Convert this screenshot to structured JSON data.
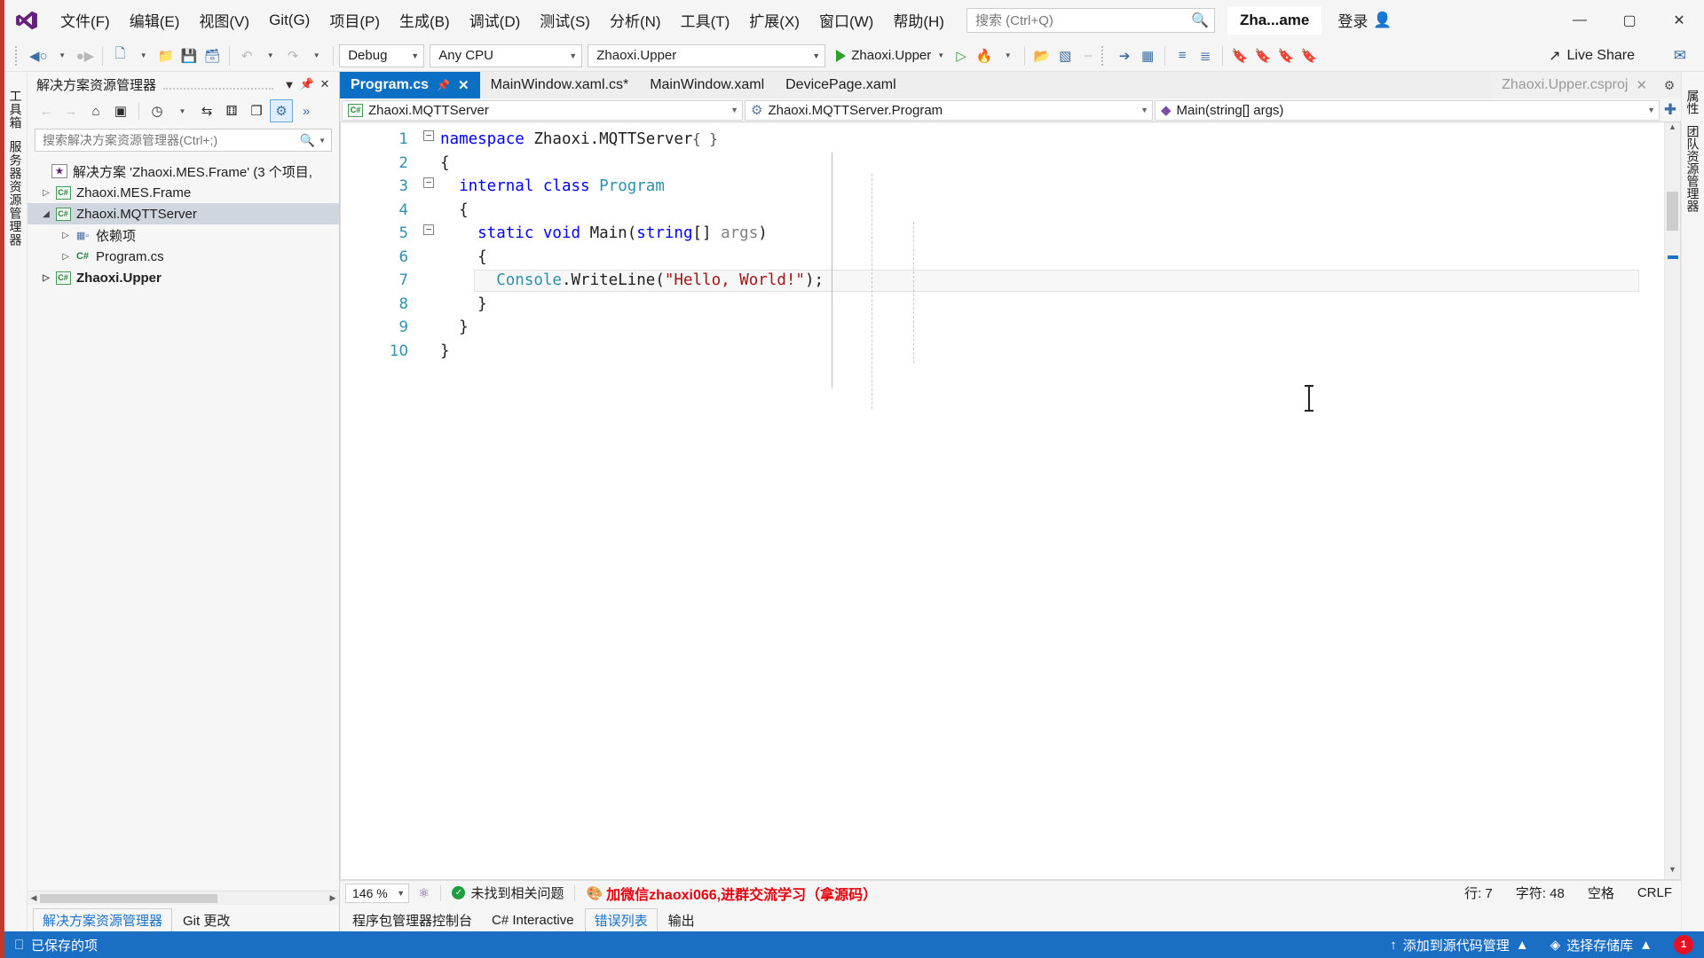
{
  "titlebar": {
    "logo_icon": "visual-studio-logo-icon",
    "menus": [
      {
        "label": "文件(F)"
      },
      {
        "label": "编辑(E)"
      },
      {
        "label": "视图(V)"
      },
      {
        "label": "Git(G)"
      },
      {
        "label": "项目(P)"
      },
      {
        "label": "生成(B)"
      },
      {
        "label": "调试(D)"
      },
      {
        "label": "测试(S)"
      },
      {
        "label": "分析(N)"
      },
      {
        "label": "工具(T)"
      },
      {
        "label": "扩展(X)"
      },
      {
        "label": "窗口(W)"
      },
      {
        "label": "帮助(H)"
      }
    ],
    "search_placeholder": "搜索 (Ctrl+Q)",
    "search_icon": "magnifier-icon",
    "solution_name": "Zha...ame",
    "signin_label": "登录",
    "signin_icon": "person-icon",
    "window_minimize": "—",
    "window_maximize": "▢",
    "window_close": "✕"
  },
  "toolbar": {
    "back_icon": "navigate-back-icon",
    "forward_icon": "navigate-forward-icon",
    "new_project_icon": "new-project-icon",
    "open_icon": "open-folder-icon",
    "save_icon": "save-icon",
    "save_all_icon": "save-all-icon",
    "undo_icon": "undo-icon",
    "redo_icon": "redo-icon",
    "config_value": "Debug",
    "platform_value": "Any CPU",
    "startup_project_value": "Zhaoxi.Upper",
    "run_label": "Zhaoxi.Upper",
    "run_icon": "play-icon",
    "run_nodebug_icon": "play-outline-icon",
    "hotreload_icon": "hot-reload-flame-icon",
    "selection_icon": "selection-icon",
    "comment_icon": "comment-icon",
    "bookmark_icon": "bookmark-icon",
    "live_share_label": "Live Share",
    "live_share_icon": "live-share-icon",
    "feedback_icon": "feedback-icon"
  },
  "left_strip": {
    "tabs": [
      {
        "label": "工具箱"
      },
      {
        "label": "服务器资源管理器"
      }
    ]
  },
  "right_strip": {
    "tabs": [
      {
        "label": "属性"
      },
      {
        "label": "团队资源管理器"
      }
    ]
  },
  "solution_explorer": {
    "title": "解决方案资源管理器",
    "pin_icon": "pin-icon",
    "dropdown_icon": "chevron-down-icon",
    "close_icon": "close-icon",
    "toolbar_icons": [
      {
        "name": "back-icon",
        "glyph": "←"
      },
      {
        "name": "forward-icon",
        "glyph": "→"
      },
      {
        "name": "home-icon",
        "glyph": "⌂"
      },
      {
        "name": "pending-changes-icon",
        "glyph": "▣"
      },
      {
        "name": "history-clock-icon",
        "glyph": "◷"
      },
      {
        "name": "sync-with-active-document-icon",
        "glyph": "⇆"
      },
      {
        "name": "collapse-all-icon",
        "glyph": "⊟"
      },
      {
        "name": "show-all-files-icon",
        "glyph": "❐"
      },
      {
        "name": "properties-icon",
        "glyph": "⚲"
      }
    ],
    "search_placeholder": "搜索解决方案资源管理器(Ctrl+;)",
    "search_icon": "magnifier-icon",
    "tree": [
      {
        "label": "解决方案 'Zhaoxi.MES.Frame' (3 个项目,",
        "indent": 0,
        "icon": "solution-icon",
        "twisty": "",
        "selected": false,
        "bold": false
      },
      {
        "label": "Zhaoxi.MES.Frame",
        "indent": 1,
        "icon": "csharp-project-icon",
        "twisty": "▷",
        "selected": false,
        "bold": false
      },
      {
        "label": "Zhaoxi.MQTTServer",
        "indent": 1,
        "icon": "csharp-project-icon",
        "twisty": "◢",
        "selected": true,
        "bold": false
      },
      {
        "label": "依赖项",
        "indent": 2,
        "icon": "dependencies-icon",
        "twisty": "▷",
        "selected": false,
        "bold": false
      },
      {
        "label": "Program.cs",
        "indent": 2,
        "icon": "csharp-file-icon",
        "twisty": "▷",
        "selected": false,
        "bold": false
      },
      {
        "label": "Zhaoxi.Upper",
        "indent": 1,
        "icon": "csharp-project-icon",
        "twisty": "▷",
        "selected": false,
        "bold": true
      }
    ],
    "bottom_tabs": [
      {
        "label": "解决方案资源管理器",
        "active": true
      },
      {
        "label": "Git 更改",
        "active": false
      }
    ]
  },
  "editor": {
    "tabs": [
      {
        "label": "Program.cs",
        "active": true,
        "pinned": true,
        "closable": true
      },
      {
        "label": "MainWindow.xaml.cs*",
        "active": false,
        "pinned": false,
        "closable": false
      },
      {
        "label": "MainWindow.xaml",
        "active": false,
        "pinned": false,
        "closable": false
      },
      {
        "label": "DevicePage.xaml",
        "active": false,
        "pinned": false,
        "closable": false
      }
    ],
    "ghost_tab": "Zhaoxi.Upper.csproj",
    "ghost_close_icon": "close-icon",
    "tabstrip_menu_icon": "gear-icon",
    "nav": {
      "project": "Zhaoxi.MQTTServer",
      "project_icon": "csharp-project-icon",
      "type": "Zhaoxi.MQTTServer.Program",
      "type_icon": "class-icon",
      "member": "Main(string[] args)",
      "member_icon": "method-icon",
      "add_icon": "plus-icon"
    },
    "code_lines": [
      {
        "n": 1,
        "fold": "minus",
        "tokens": [
          {
            "t": "namespace ",
            "c": "kw"
          },
          {
            "t": "Zhaoxi.MQTTServer",
            "c": "ns"
          }
        ]
      },
      {
        "n": 2,
        "fold": "",
        "tokens": [
          {
            "t": "{",
            "c": "ns"
          }
        ]
      },
      {
        "n": 3,
        "fold": "minus",
        "tokens": [
          {
            "t": "  internal class ",
            "c": "kw"
          },
          {
            "t": "Program",
            "c": "tp"
          }
        ]
      },
      {
        "n": 4,
        "fold": "",
        "tokens": [
          {
            "t": "  {",
            "c": "ns"
          }
        ]
      },
      {
        "n": 5,
        "fold": "minus",
        "tokens": [
          {
            "t": "    static void ",
            "c": "kw"
          },
          {
            "t": "Main",
            "c": "ns"
          },
          {
            "t": "(",
            "c": "ns"
          },
          {
            "t": "string",
            "c": "kw"
          },
          {
            "t": "[] ",
            "c": "ns"
          },
          {
            "t": "args",
            "c": "prm"
          },
          {
            "t": ")",
            "c": "ns"
          }
        ]
      },
      {
        "n": 6,
        "fold": "",
        "tokens": [
          {
            "t": "    {",
            "c": "ns"
          }
        ]
      },
      {
        "n": 7,
        "fold": "",
        "tokens": [
          {
            "t": "      ",
            "c": "ns"
          },
          {
            "t": "Console",
            "c": "tp"
          },
          {
            "t": ".WriteLine(",
            "c": "ns"
          },
          {
            "t": "\"Hello, World!\"",
            "c": "st"
          },
          {
            "t": ");",
            "c": "ns"
          }
        ]
      },
      {
        "n": 8,
        "fold": "",
        "tokens": [
          {
            "t": "    }",
            "c": "ns"
          }
        ]
      },
      {
        "n": 9,
        "fold": "",
        "tokens": [
          {
            "t": "  }",
            "c": "ns"
          }
        ]
      },
      {
        "n": 10,
        "fold": "",
        "tokens": [
          {
            "t": "}",
            "c": "ns"
          }
        ]
      }
    ],
    "status": {
      "zoom": "146 %",
      "zoom_caret_icon": "chevron-down-icon",
      "intellicode_icon": "intellicode-icon",
      "issues_icon": "check-circle-icon",
      "issues_label": "未找到相关问题",
      "promo_icon": "broom-icon",
      "promo_text": "加微信zhaoxi066,进群交流学习（拿源码）",
      "line_label": "行: 7",
      "col_label": "字符: 48",
      "space_label": "空格",
      "eol_label": "CRLF"
    },
    "bottom_tabs": [
      {
        "label": "程序包管理器控制台",
        "active": false
      },
      {
        "label": "C# Interactive",
        "active": false
      },
      {
        "label": "错误列表",
        "active": true
      },
      {
        "label": "输出",
        "active": false
      }
    ]
  },
  "statusbar": {
    "save_icon": "saved-item-icon",
    "save_label": "已保存的项",
    "source_control_icon": "upload-icon",
    "source_control_label": "添加到源代码管理",
    "source_control_caret": "▲",
    "repo_icon": "repository-icon",
    "repo_label": "选择存储库",
    "repo_caret": "▲",
    "bell_icon": "bell-icon",
    "bell_count": "1"
  },
  "colors": {
    "accent_blue": "#1a6fc4",
    "tab_active": "#0b6fc4",
    "promo_red": "#e8000d",
    "keyword_blue": "#0000ff",
    "type_teal": "#2b91af",
    "string_red": "#a31515",
    "left_edge_red": "#c0392b"
  }
}
